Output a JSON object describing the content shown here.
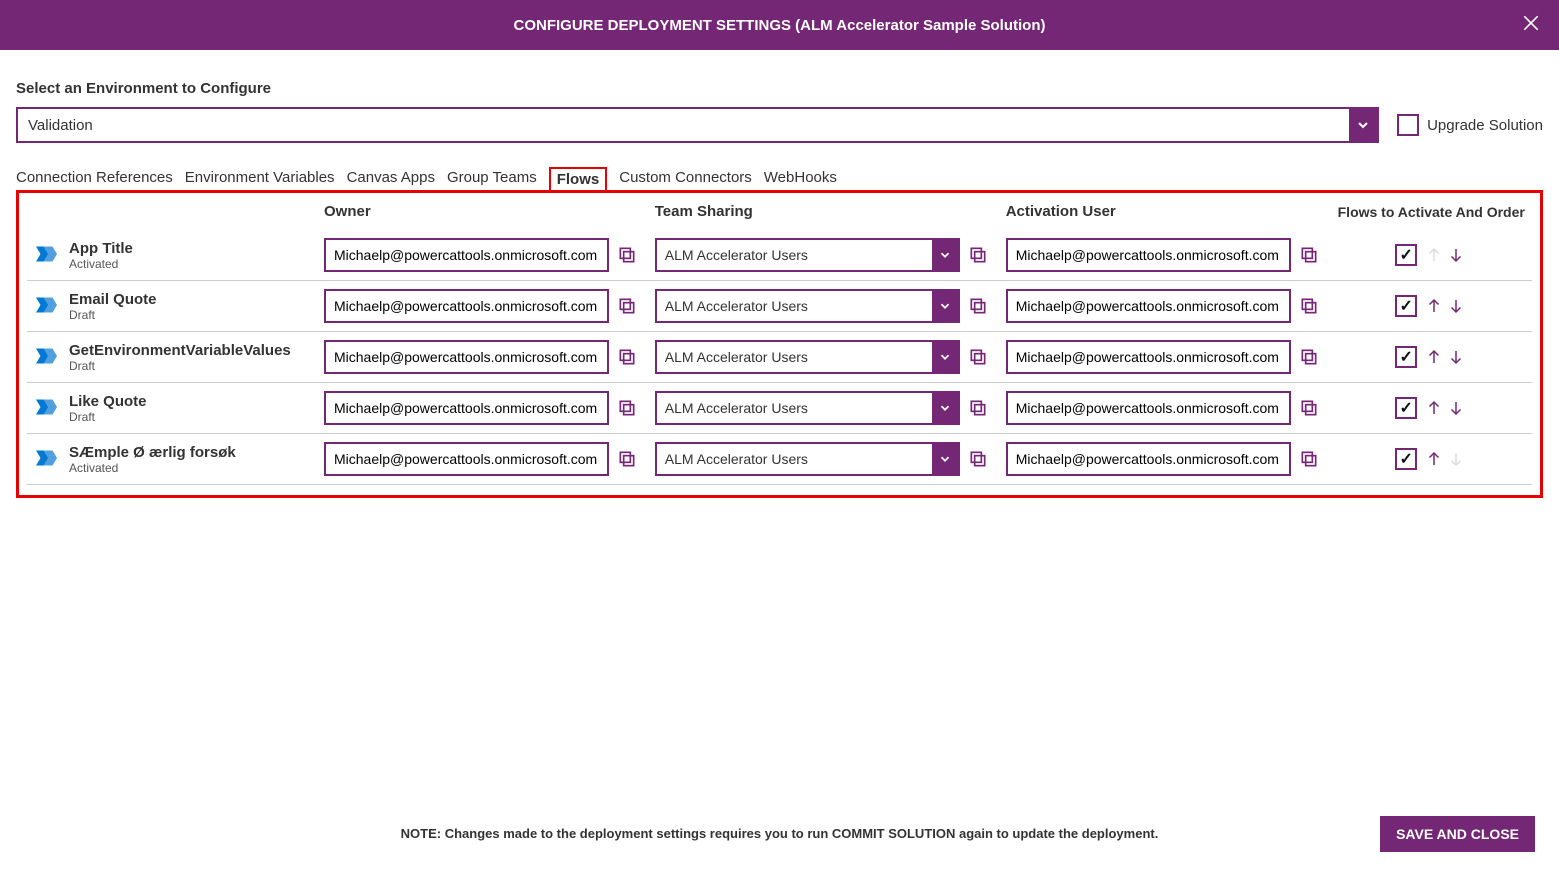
{
  "header": {
    "title": "CONFIGURE DEPLOYMENT SETTINGS (ALM Accelerator Sample Solution)"
  },
  "env": {
    "label": "Select an Environment to Configure",
    "selected": "Validation",
    "upgrade_label": "Upgrade Solution",
    "upgrade_checked": false
  },
  "tabs": [
    {
      "label": "Connection References",
      "active": false
    },
    {
      "label": "Environment Variables",
      "active": false
    },
    {
      "label": "Canvas Apps",
      "active": false
    },
    {
      "label": "Group Teams",
      "active": false
    },
    {
      "label": "Flows",
      "active": true
    },
    {
      "label": "Custom Connectors",
      "active": false
    },
    {
      "label": "WebHooks",
      "active": false
    }
  ],
  "columns": {
    "owner": "Owner",
    "team": "Team Sharing",
    "activation": "Activation User",
    "activate_order": "Flows to Activate And Order"
  },
  "flows": [
    {
      "name": "App Title",
      "status": "Activated",
      "owner": "Michaelp@powercattools.onmicrosoft.com",
      "team": "ALM Accelerator Users",
      "activation": "Michaelp@powercattools.onmicrosoft.com",
      "checked": true,
      "up": false,
      "down": true
    },
    {
      "name": "Email Quote",
      "status": "Draft",
      "owner": "Michaelp@powercattools.onmicrosoft.com",
      "team": "ALM Accelerator Users",
      "activation": "Michaelp@powercattools.onmicrosoft.com",
      "checked": true,
      "up": true,
      "down": true
    },
    {
      "name": "GetEnvironmentVariableValues",
      "status": "Draft",
      "owner": "Michaelp@powercattools.onmicrosoft.com",
      "team": "ALM Accelerator Users",
      "activation": "Michaelp@powercattools.onmicrosoft.com",
      "checked": true,
      "up": true,
      "down": true
    },
    {
      "name": "Like Quote",
      "status": "Draft",
      "owner": "Michaelp@powercattools.onmicrosoft.com",
      "team": "ALM Accelerator Users",
      "activation": "Michaelp@powercattools.onmicrosoft.com",
      "checked": true,
      "up": true,
      "down": true
    },
    {
      "name": "SÆmple Ø ærlig forsøk",
      "status": "Activated",
      "owner": "Michaelp@powercattools.onmicrosoft.com",
      "team": "ALM Accelerator Users",
      "activation": "Michaelp@powercattools.onmicrosoft.com",
      "checked": true,
      "up": true,
      "down": false
    }
  ],
  "footer": {
    "note": "NOTE: Changes made to the deployment settings requires you to run COMMIT SOLUTION again to update the deployment.",
    "save_label": "SAVE AND CLOSE"
  }
}
